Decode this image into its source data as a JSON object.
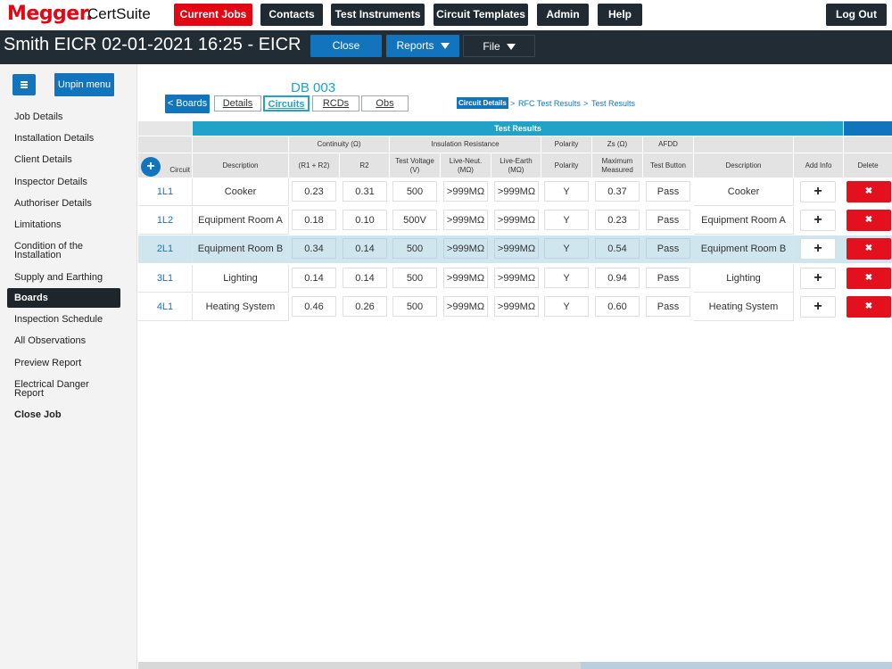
{
  "app": {
    "logo": "Megger.",
    "logo_suffix": "CertSuite"
  },
  "topnav": {
    "current_jobs": "Current Jobs",
    "contacts": "Contacts",
    "test_instruments": "Test Instruments",
    "circuit_templates": "Circuit Templates",
    "admin": "Admin",
    "help": "Help",
    "logout": "Log Out"
  },
  "titlebar": {
    "title": "Smith EICR 02-01-2021 16:25 - EICR",
    "close": "Close",
    "reports": "Reports",
    "file": "File"
  },
  "sidebar": {
    "unpin": "Unpin menu",
    "items": [
      "Job Details",
      "Installation Details",
      "Client Details",
      "Inspector Details",
      "Authoriser Details",
      "Limitations",
      "Condition of the Installation",
      "Supply and Earthing",
      "Boards",
      "Inspection Schedule",
      "All Observations",
      "Preview Report",
      "Electrical Danger Report",
      "Close Job"
    ]
  },
  "board": {
    "title": "DB 003",
    "back": "< Boards",
    "tabs": [
      "Details",
      "Circuits",
      "RCDs",
      "Obs"
    ],
    "crumbs": [
      "Circuit Details",
      "RFC Test Results",
      "Test Results"
    ]
  },
  "table": {
    "section_title": "Test Results",
    "groups": {
      "continuity": "Continuity (Ω)",
      "insulation": "Insulation Resistance",
      "polarity": "Polarity",
      "zs": "Zs (Ω)",
      "afdd": "AFDD"
    },
    "columns": {
      "circuit": "Circuit",
      "description": "Description",
      "r1r2": "(R1 + R2)",
      "r2": "R2",
      "test_voltage": "Test Voltage (V)",
      "live_neut": "Live-Neut. (MΩ)",
      "live_earth": "Live-Earth (MΩ)",
      "polarity": "Polarity",
      "max_measured": "Maximum Measured",
      "test_button": "Test Button",
      "description2": "Description",
      "add_info": "Add Info",
      "delete": "Delete"
    },
    "rows": [
      {
        "circuit": "1L1",
        "desc": "Cooker",
        "r1r2": "0.23",
        "r2": "0.31",
        "voltage": "500",
        "ln": ">999MΩ",
        "le": ">999MΩ",
        "polarity": "Y",
        "zs": "0.37",
        "afdd": "Pass",
        "desc2": "Cooker"
      },
      {
        "circuit": "1L2",
        "desc": "Equipment Room A",
        "r1r2": "0.18",
        "r2": "0.10",
        "voltage": "500V",
        "ln": ">999MΩ",
        "le": ">999MΩ",
        "polarity": "Y",
        "zs": "0.23",
        "afdd": "Pass",
        "desc2": "Equipment Room A"
      },
      {
        "circuit": "2L1",
        "desc": "Equipment Room B",
        "r1r2": "0.34",
        "r2": "0.14",
        "voltage": "500",
        "ln": ">999MΩ",
        "le": ">999MΩ",
        "polarity": "Y",
        "zs": "0.54",
        "afdd": "Pass",
        "desc2": "Equipment Room B"
      },
      {
        "circuit": "3L1",
        "desc": "Lighting",
        "r1r2": "0.14",
        "r2": "0.14",
        "voltage": "500",
        "ln": ">999MΩ",
        "le": ">999MΩ",
        "polarity": "Y",
        "zs": "0.94",
        "afdd": "Pass",
        "desc2": "Lighting"
      },
      {
        "circuit": "4L1",
        "desc": "Heating System",
        "r1r2": "0.46",
        "r2": "0.26",
        "voltage": "500",
        "ln": ">999MΩ",
        "le": ">999MΩ",
        "polarity": "Y",
        "zs": "0.60",
        "afdd": "Pass",
        "desc2": "Heating System"
      }
    ],
    "add_symbol": "+",
    "delete_symbol": "✖"
  },
  "colors": {
    "brand_red": "#e30613",
    "primary_blue": "#1374be",
    "teal": "#21a3c9",
    "dark": "#222c34"
  }
}
